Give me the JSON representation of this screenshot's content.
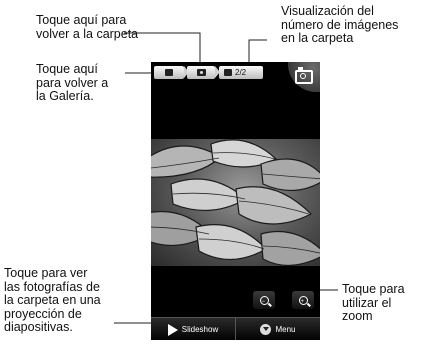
{
  "annotations": {
    "folder": "Toque aquí para\nvolver a la carpeta",
    "count": "Visualización del\nnúmero de imágenes\nen la carpeta",
    "gallery": "Toque aquí\npara volver a\nla Galería.",
    "slideshow": "Toque para ver\nlas fotografías de\nla carpeta en una\nproyección de\ndiapositivas.",
    "zoom": "Toque para\nutilizar el\nzoom"
  },
  "screen": {
    "breadcrumb": {
      "gallery_icon": "gallery-icon",
      "folder_icon": "camera-folder-icon",
      "image_icon": "image-icon",
      "image_count": "2/2"
    },
    "camera_button_icon": "camera-icon",
    "photo_subject": "leaves",
    "zoom_out_icon": "zoom-out-icon",
    "zoom_in_icon": "zoom-in-icon",
    "bottom_bar": {
      "slideshow_label": "Slideshow",
      "menu_label": "Menu"
    }
  }
}
